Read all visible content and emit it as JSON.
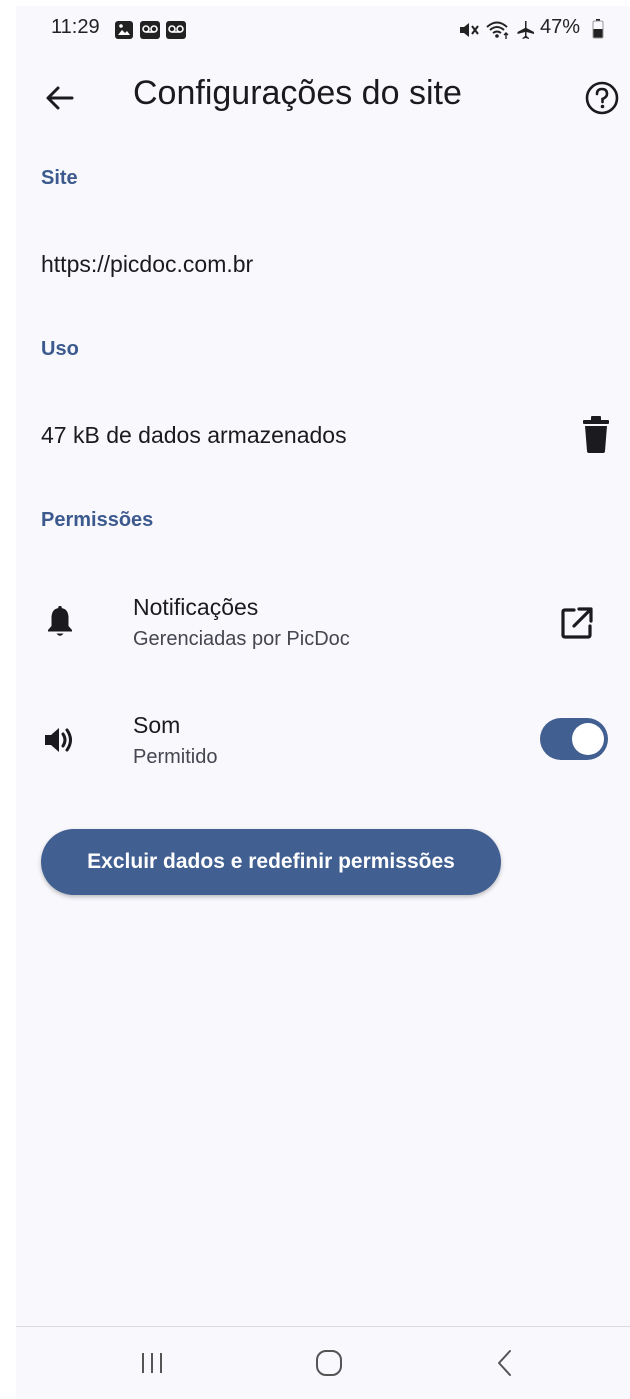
{
  "status_bar": {
    "time": "11:29",
    "battery": "47%",
    "icons": [
      "image-icon",
      "voicemail-icon",
      "voicemail-icon",
      "mute-icon",
      "wifi-icon",
      "airplane-icon",
      "battery-icon"
    ]
  },
  "app_bar": {
    "title": "Configurações do site",
    "back_icon": "arrow-back-icon",
    "help_icon": "help-circle-icon"
  },
  "site": {
    "header": "Site",
    "url": "https://picdoc.com.br"
  },
  "usage": {
    "header": "Uso",
    "stored": "47 kB de dados armazenados",
    "delete_icon": "trash-icon"
  },
  "permissions": {
    "header": "Permissões",
    "items": [
      {
        "title": "Notificações",
        "subtitle": "Gerenciadas por PicDoc",
        "icon": "bell-icon",
        "action": "open-external-icon"
      },
      {
        "title": "Som",
        "subtitle": "Permitido",
        "icon": "speaker-icon",
        "enabled": true
      }
    ]
  },
  "reset_button": {
    "label": "Excluir dados e redefinir permissões"
  },
  "colors": {
    "accent": "#415f91",
    "section_header": "#3c5a8e",
    "background": "#f8f8fd"
  },
  "nav": {
    "items": [
      "recent-apps-icon",
      "home-icon",
      "back-icon"
    ]
  }
}
